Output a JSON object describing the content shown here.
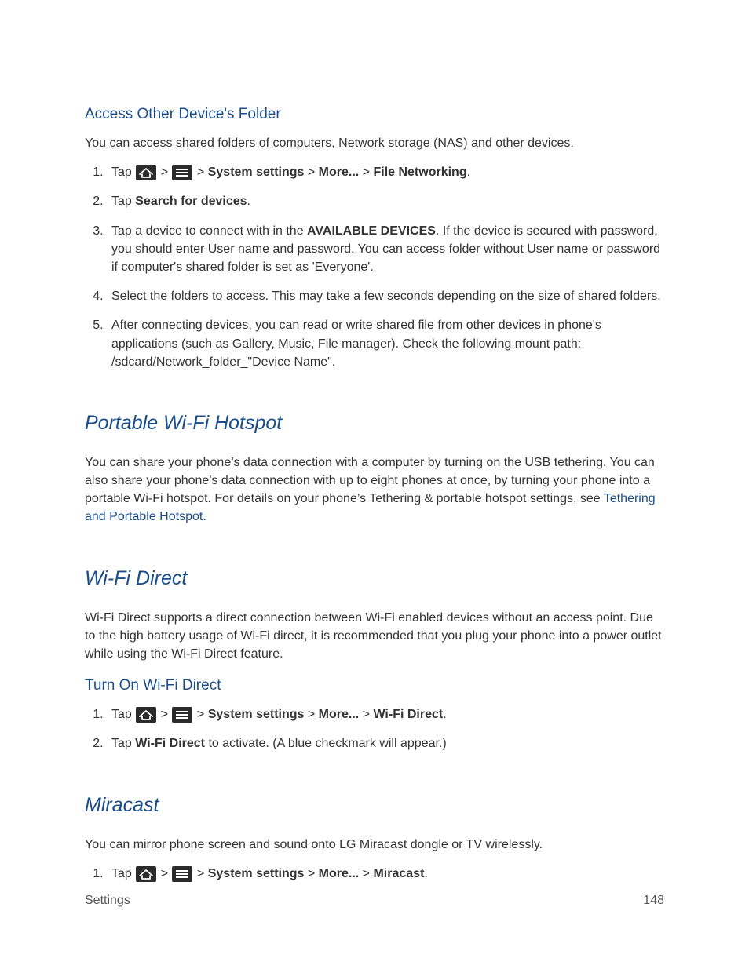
{
  "sec_access": {
    "title": "Access Other Device's Folder",
    "intro": "You can access shared folders of computers, Network storage (NAS) and other devices.",
    "step1_a": "Tap ",
    "step1_b": " > ",
    "step1_c": " > ",
    "step1_sys": "System settings",
    "step1_d": " > ",
    "step1_more": "More...",
    "step1_e": " > ",
    "step1_fn": "File Networking",
    "step1_f": ".",
    "step2_a": "Tap ",
    "step2_b": "Search for devices",
    "step2_c": ".",
    "step3_a": "Tap a device to connect with in the ",
    "step3_b": "AVAILABLE DEVICES",
    "step3_c": ". If the device is secured with password, you should enter User name and password. You can access folder without User name or password if computer's shared folder is set as 'Everyone'.",
    "step4": "Select the folders to access. This may take a few seconds depending on the size of shared folders.",
    "step5": "After connecting devices, you can read or write shared file from other devices in phone's applications (such as Gallery, Music, File manager). Check the following mount path: /sdcard/Network_folder_\"Device Name\"."
  },
  "sec_hotspot": {
    "title": "Portable Wi-Fi Hotspot",
    "p_a": "You can share your phone’s data connection with a computer by turning on the USB tethering. You can also share your phone's data connection with up to eight phones at once, by turning your phone into a portable Wi-Fi hotspot. For details on your phone’s Tethering & portable hotspot settings, see ",
    "p_link": "Tethering and Portable Hotspot.",
    "p_b": ""
  },
  "sec_wifidirect": {
    "title": "Wi-Fi Direct",
    "intro": "Wi-Fi Direct supports a direct connection between Wi-Fi enabled devices without an access point. Due to the high battery usage of Wi-Fi direct, it is recommended that you plug your phone into a power outlet while using the Wi-Fi Direct feature.",
    "sub": "Turn On Wi-Fi Direct",
    "step1_a": "Tap ",
    "step1_b": " > ",
    "step1_c": " > ",
    "step1_sys": "System settings",
    "step1_d": " > ",
    "step1_more": "More...",
    "step1_e": " > ",
    "step1_wd": "Wi-Fi Direct",
    "step1_f": ".",
    "step2_a": "Tap ",
    "step2_b": "Wi-Fi Direct",
    "step2_c": " to activate. (A blue checkmark will appear.)"
  },
  "sec_miracast": {
    "title": "Miracast",
    "intro": "You can mirror phone screen and sound onto LG Miracast dongle or TV wirelessly.",
    "step1_a": "Tap ",
    "step1_b": " > ",
    "step1_c": " > ",
    "step1_sys": "System settings",
    "step1_d": " > ",
    "step1_more": "More...",
    "step1_e": " > ",
    "step1_mc": "Miracast",
    "step1_f": "."
  },
  "footer": {
    "left": "Settings",
    "right": "148"
  }
}
